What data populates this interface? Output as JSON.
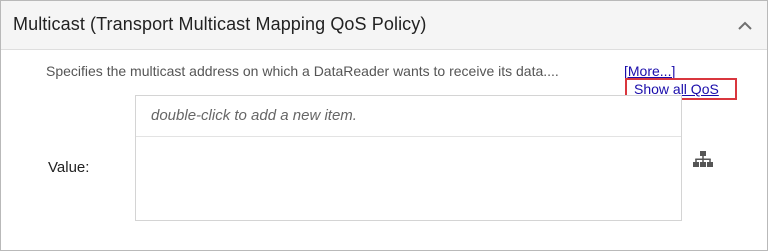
{
  "panel": {
    "title": "Multicast (Transport Multicast Mapping QoS Policy)",
    "description": "Specifies the multicast address on which a DataReader wants to receive its data....",
    "more_link": "[More...]",
    "show_all_link": "Show all QoS"
  },
  "field": {
    "label": "Value:",
    "placeholder_text": "double-click to add a new item."
  },
  "icons": {
    "collapse": "chevron-up-icon",
    "hierarchy": "hierarchy-icon"
  },
  "colors": {
    "link": "#1a0dab",
    "highlight_border": "#d9363e",
    "header_bg": "#f5f5f5"
  }
}
